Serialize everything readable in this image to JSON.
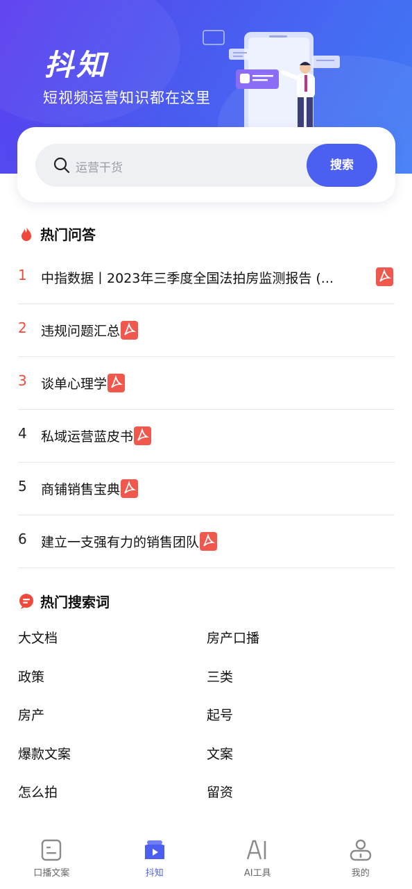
{
  "hero": {
    "brand": "抖知",
    "slogan": "短视频运营知识都在这里"
  },
  "search": {
    "placeholder": "运营干货",
    "button_label": "搜索"
  },
  "hot_qa": {
    "title": "热门问答",
    "items": [
      {
        "rank": "1",
        "title": "中指数据丨2023年三季度全国法拍房监测报告 (..."
      },
      {
        "rank": "2",
        "title": "违规问题汇总"
      },
      {
        "rank": "3",
        "title": "谈单心理学"
      },
      {
        "rank": "4",
        "title": "私域运营蓝皮书"
      },
      {
        "rank": "5",
        "title": "商铺销售宝典"
      },
      {
        "rank": "6",
        "title": "建立一支强有力的销售团队"
      }
    ]
  },
  "hot_search": {
    "title": "热门搜索词",
    "keywords": [
      "大文档",
      "房产口播",
      "政策",
      "三类",
      "房产",
      "起号",
      "爆款文案",
      "文案",
      "怎么拍",
      "留资"
    ]
  },
  "tabbar": {
    "items": [
      {
        "label": "口播文案",
        "icon": "script-icon"
      },
      {
        "label": "抖知",
        "icon": "play-book-icon"
      },
      {
        "label": "AI工具",
        "icon": "ai-icon"
      },
      {
        "label": "我的",
        "icon": "profile-icon"
      }
    ],
    "active_index": 1
  },
  "colors": {
    "accent": "#4b5ff0",
    "hot_rank": "#f04b3a",
    "pdf": "#f0574d"
  }
}
